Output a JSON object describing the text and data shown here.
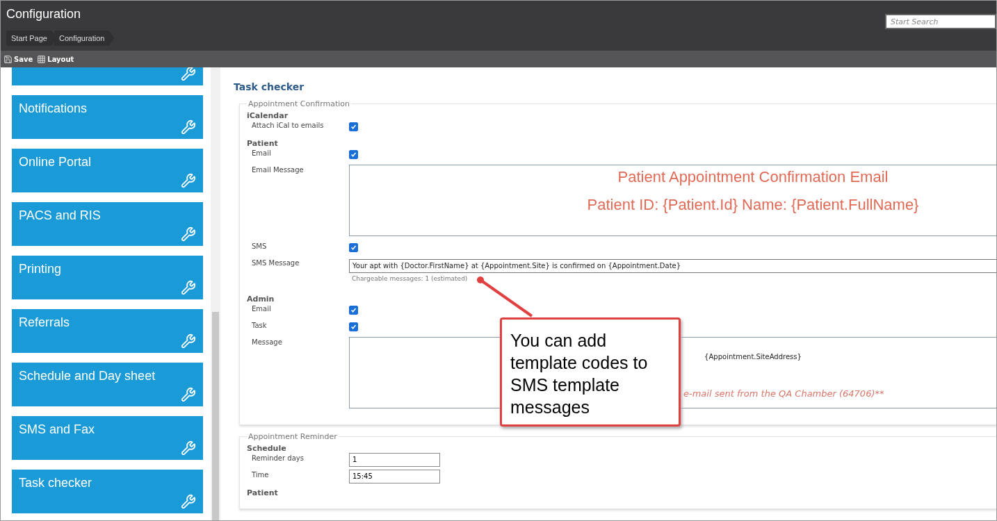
{
  "header": {
    "title": "Configuration",
    "search": {
      "placeholder": "Start Search"
    }
  },
  "breadcrumbs": [
    "Start Page",
    "Configuration"
  ],
  "toolbar": [
    {
      "label": "Save",
      "kind": "save"
    },
    {
      "label": "Layout",
      "kind": "layout"
    }
  ],
  "sidebar": {
    "items": [
      {
        "label": "Notifications"
      },
      {
        "label": "Online Portal"
      },
      {
        "label": "PACS and RIS"
      },
      {
        "label": "Printing"
      },
      {
        "label": "Referrals"
      },
      {
        "label": "Schedule and Day sheet"
      },
      {
        "label": "SMS and Fax"
      },
      {
        "label": "Task checker"
      }
    ]
  },
  "page_title": "Task checker",
  "sections": [
    {
      "legend": "Appointment Confirmation",
      "groups": [
        {
          "heading": "iCalendar",
          "rows": [
            {
              "kind": "checkbox",
              "label": "Attach iCal to emails",
              "checked": true
            }
          ]
        },
        {
          "heading": "Patient",
          "rows": [
            {
              "kind": "checkbox",
              "label": "Email",
              "checked": true
            },
            {
              "kind": "richtext",
              "label": "Email Message",
              "lines": [
                {
                  "kind": "title",
                  "text": "Patient Appointment Confirmation Email"
                },
                {
                  "kind": "title",
                  "text": "Patient ID: {Patient.Id} Name: {Patient.FullName}"
                }
              ]
            },
            {
              "kind": "checkbox",
              "label": "SMS",
              "checked": true
            },
            {
              "kind": "textline",
              "label": "SMS Message",
              "value": "Your apt with {Doctor.FirstName} at {Appointment.Site} is confirmed on {Appointment.Date}",
              "note": "Chargeable messages: 1 (estimated)"
            }
          ]
        },
        {
          "heading": "Admin",
          "rows": [
            {
              "kind": "checkbox",
              "label": "Email",
              "checked": true
            },
            {
              "kind": "checkbox",
              "label": "Task",
              "checked": true
            },
            {
              "kind": "richtext",
              "label": "Message",
              "lines": [
                {
                  "kind": "code",
                  "text": "{Appointment.SiteAddress}"
                },
                {
                  "kind": "note",
                  "text": "e-mail sent from the QA Chamber (64706)**"
                }
              ]
            }
          ]
        }
      ]
    },
    {
      "legend": "Appointment Reminder",
      "groups": [
        {
          "heading": "Schedule",
          "rows": [
            {
              "kind": "input",
              "label": "Reminder days",
              "value": "1"
            },
            {
              "kind": "input",
              "label": "Time",
              "value": "15:45"
            }
          ]
        },
        {
          "heading": "Patient"
        }
      ]
    }
  ],
  "callout": {
    "text": "You can add template codes to SMS template messages"
  }
}
